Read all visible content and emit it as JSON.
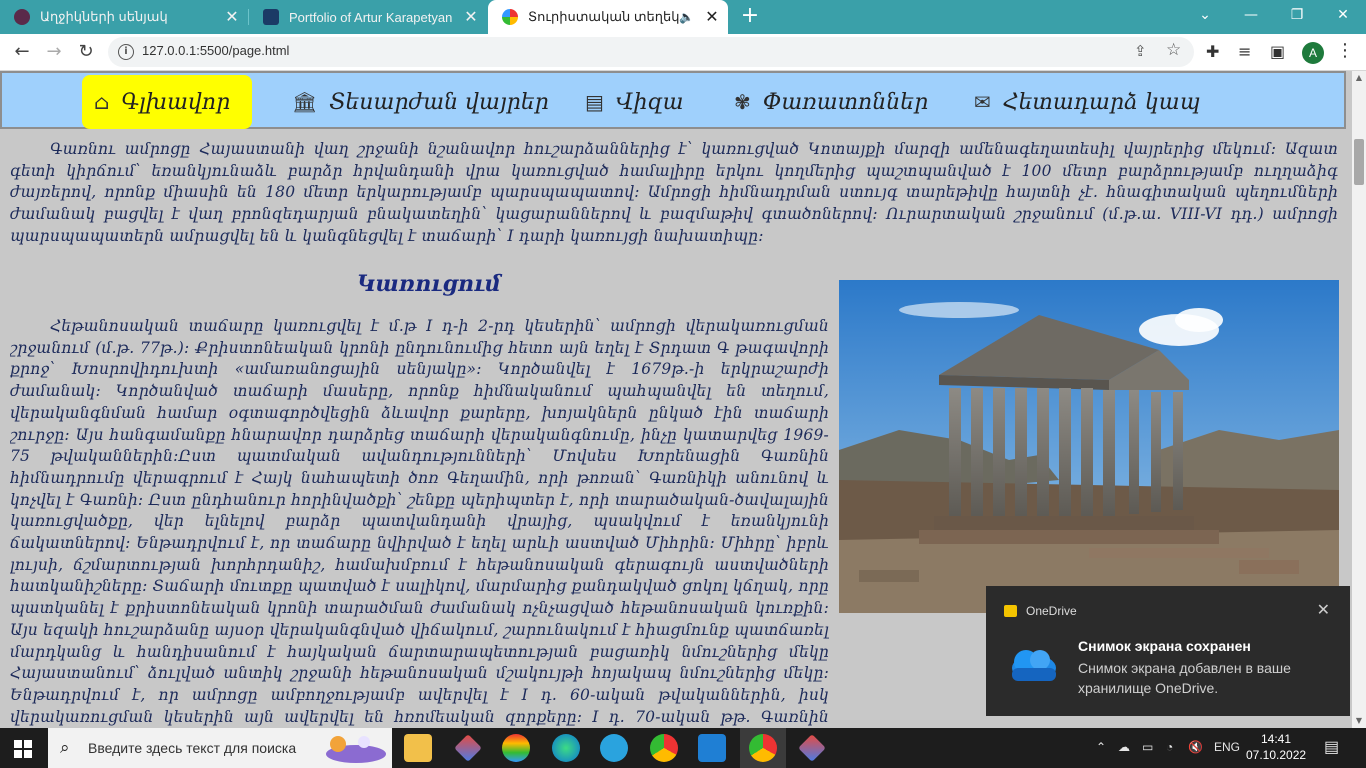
{
  "browser": {
    "tabs": [
      {
        "title": "Աղջիկների սենյակ"
      },
      {
        "title": "Portfolio of Artur Karapetyan"
      },
      {
        "title": "Տուրիստական տեղեկատու"
      }
    ],
    "url": "127.0.0.1:5500/page.html",
    "profile_initial": "A"
  },
  "nav": {
    "items": [
      {
        "label": "Գլխավոր",
        "icon": "home-icon"
      },
      {
        "label": "Տեսարժան վայրեր",
        "icon": "landmark-icon"
      },
      {
        "label": "Վիզա",
        "icon": "visa-icon"
      },
      {
        "label": "Փառատոններ",
        "icon": "festival-icon"
      },
      {
        "label": "Հետադարձ կապ",
        "icon": "contact-icon"
      }
    ]
  },
  "content": {
    "intro": "Գառնու ամրոցը Հայաստանի վաղ շրջանի նշանավոր հուշարձաններից է՝ կառուցված Կոտայքի մարզի ամենագեղատեսիլ վայրերից մեկում: Ազատ գետի կիրճում՝ եռանկյունաձև բարձր հրվանդանի վրա կառուցված համալիրը երկու կողմերից պաշտպանված է 100 մետր բարձրությամբ ուղղաձիգ ժայռերով, որոնք միասին են 180 մետր երկարությամբ պարսպապատով: Ամրոցի հիմնադրման ստույգ տարեթիվը հայտնի չէ. հնագիտական պեղումների ժամանակ բացվել է վաղ բրոնզեդարյան բնակատեղին՝ կացարաններով և բազմաթիվ գտածոներով: Ուրարտական շրջանում (մ.թ.ա. VIII-VI դդ.) ամրոցի պարսպապատերն ամրացվել են և կանգնեցվել է տաճարի՝ I դարի կառույցի նախատիպը:",
    "section_title": "Կառուցում",
    "body": "Հեթանոսական տաճարը կառուցվել է մ.թ I դ-ի 2-րդ կեսերին՝ ամրոցի վերակառուցման շրջանում (մ.թ. 77թ.): Քրիստոնեական կրոնի ընդունումից հետո այն եղել է Տրդատ Գ թագավորի քրոջ՝ Խոսրովիդուխտի «ամառանոցային սենյակը»: Կործանվել է 1679թ.-ի երկրաշարժի ժամանակ: Կործանված տաճարի մասերը, որոնք հիմնականում պահպանվել են տեղում, վերականգնման համար օգտագործվեցին ձևավոր քարերը, խոյակներն ընկած էին տաճարի շուրջը: Այս հանգամանքը հնարավոր դարձրեց տաճարի վերականգնումը, ինչը կատարվեց 1969-75 թվականներին:Ըստ պատմական ավանդությունների՝ Մովսես Խորենացին Գառնին հիմնադրումը վերագրում է Հայկ նահապետի ծոռ Գեղամին, որի թոռան՝ Գառնիկի անունով և կոչվել է Գառնի: Ըստ ընդհանուր հորինվածքի՝ շենքը պերիպտեր է, որի տարածական-ծավալային կառուցվածքը, վեր ելնելով բարձր պատվանդանի վրայից, պսակվում է եռանկյունի ճակատներով: Ենթադրվում է, որ տաճարը նվիրված է եղել արևի աստված Միհրին: Միհրը՝ իբրև լույսի, ճշմարտության խորհրդանիշ, համախմբում է հեթանոսական գերագույն աստվածների հատկանիշները: Տաճարի մուտքը պատված է սալիկով, մարմարից քանդակված ցոկոլ կճղակ, որը պատկանել է քրիստոնեական կրոնի տարածման ժամանակ ոչնչացված հեթանոսական կուռքին: Այս եզակի հուշարձանը այսօր վերականգնված վիճակում, շարունակում է հիացմունք պատճառել մարդկանց և հանդիսանում է հայկական ճարտարապետության բացառիկ նմուշներից մեկը Հայաստանում՝ ձուլված անտիկ շրջանի հեթանոսական մշակույթի հոյակապ նմուշներից մեկը: Ենթադրվում է, որ ամրոցը ամբողջությամբ ավերվել է I դ. 60-ական թվականներին, իսկ վերակառուցման կեսերին այն ավերվել են հռոմեական զորքերը: I դ. 70-ական թթ. Գառնին վերականգնել է Տրդատ Ա-ն, որը հայտնի է նաև որպես ամենամեծ կառուցողներից մեկը: Արքայական իշխանության օրոք այն անվանվել է «ամարանոց ամրոց»: Արշակունի և Արշակունյաց թագավորների օրոք Գառնին եղել է նշանավոր ամրոց."
  },
  "toast": {
    "app": "OneDrive",
    "heading": "Снимок экрана сохранен",
    "body": "Снимок экрана добавлен в ваше хранилище OneDrive."
  },
  "taskbar": {
    "search_placeholder": "Введите здесь текст для поиска",
    "language": "ENG",
    "time": "14:41",
    "date": "07.10.2022"
  }
}
